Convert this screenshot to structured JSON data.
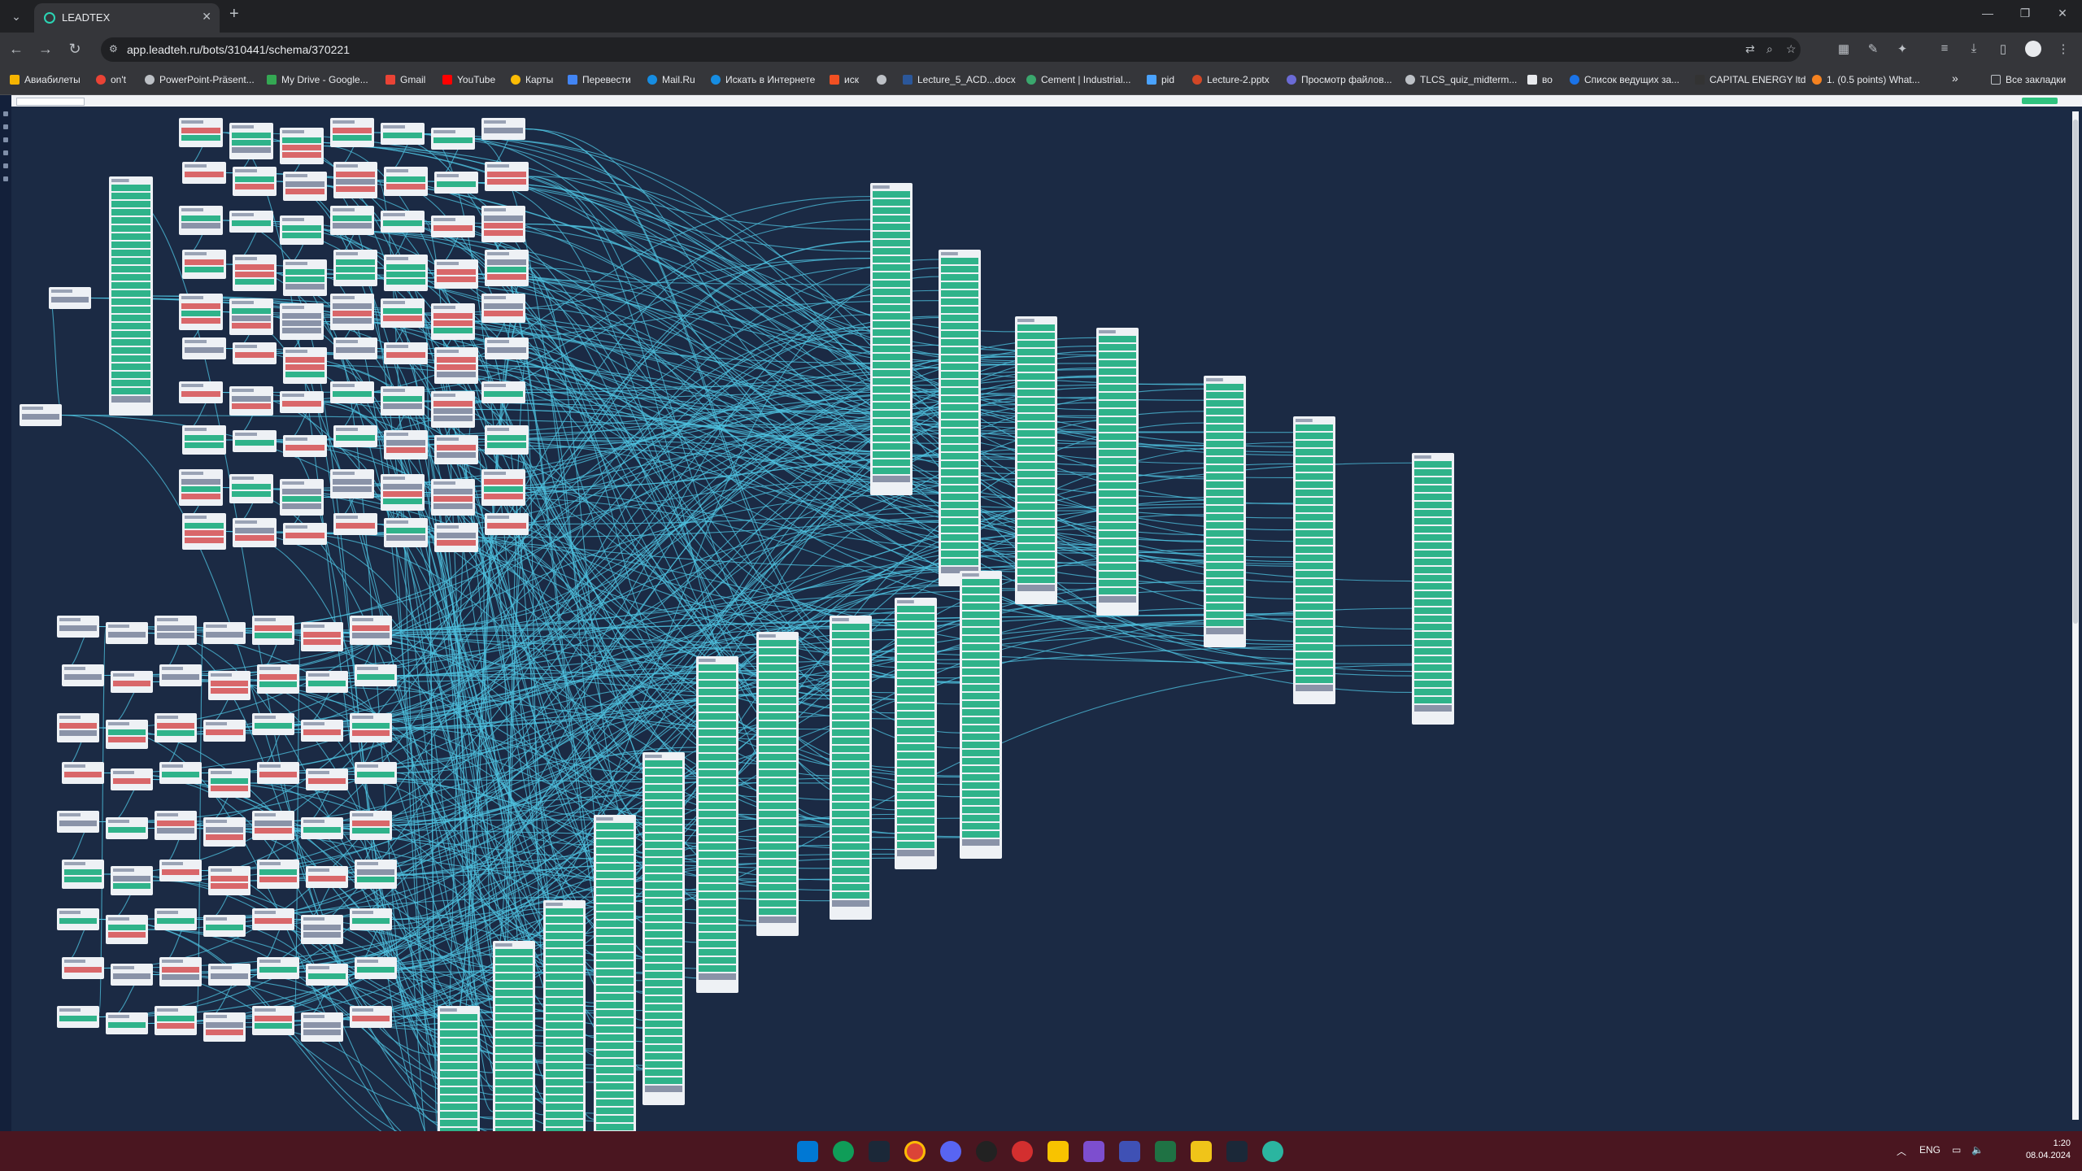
{
  "browser": {
    "tab_title": "LEADTEX",
    "url": "app.leadteh.ru/bots/310441/schema/370221",
    "bookmarks": [
      "Авиабилеты",
      "on't",
      "PowerPoint-Präsent...",
      "My Drive - Google...",
      "Gmail",
      "YouTube",
      "Карты",
      "Перевести",
      "Mail.Ru",
      "Искать в Интернете",
      "иск",
      "",
      "Lecture_5_ACD...docx",
      "Cement | Industrial...",
      "pid",
      "Lecture-2.pptx",
      "Просмотр файлов...",
      "TLCS_quiz_midterm...",
      "во",
      "Список ведущих за...",
      "CAPITAL ENERGY ltd",
      "1. (0.5 points) What..."
    ],
    "all_bookmarks": "Все закладки",
    "more": "»"
  },
  "colors": {
    "node_green": "#2fb38a",
    "node_red": "#d9676a",
    "node_gray": "#8a93a8",
    "node_white": "#eef1f5",
    "edge": "#4fc3e0",
    "canvas": "#1b2a44"
  },
  "taskbar": {
    "lang": "ENG",
    "time": "1:20",
    "date": "08.04.2024"
  }
}
